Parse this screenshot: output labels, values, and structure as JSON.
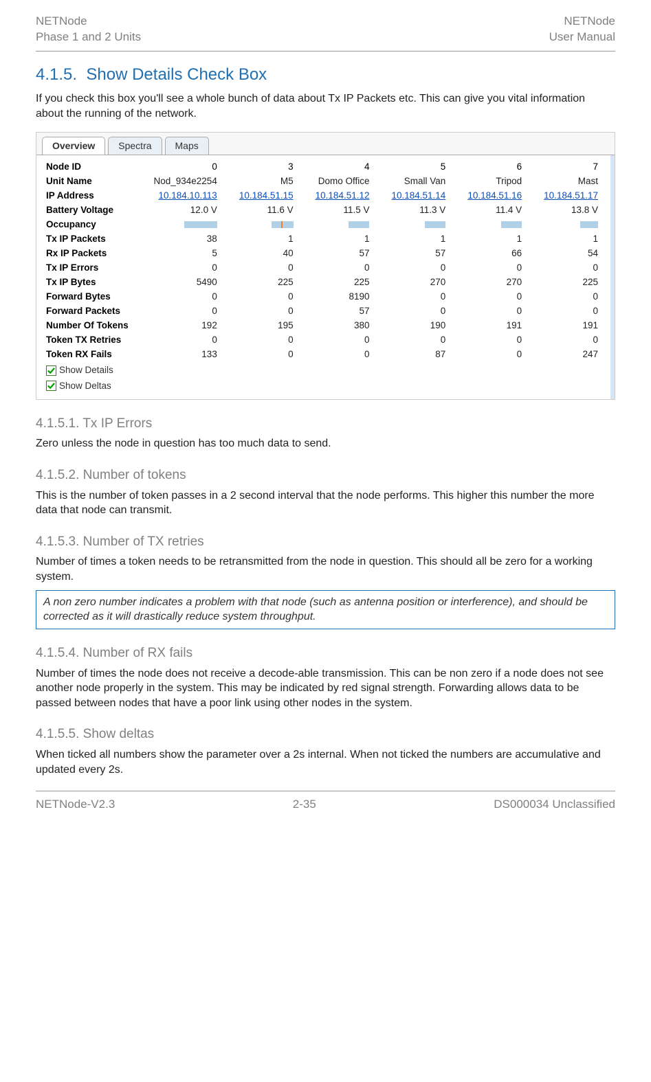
{
  "doc": {
    "header_left_1": "NETNode",
    "header_left_2": "Phase 1 and 2 Units",
    "header_right_1": "NETNode",
    "header_right_2": "User Manual",
    "footer_left": "NETNode-V2.3",
    "footer_center": "2-35",
    "footer_right": "DS000034 Unclassified"
  },
  "sections": {
    "h2_num": "4.1.5.",
    "h2_title": "Show Details Check Box",
    "p_intro": "If you check this box you'll see a whole bunch of data about Tx IP Packets etc. This can give you vital information about the running of the network.",
    "s1_h": "4.1.5.1. Tx IP Errors",
    "s1_p": "Zero unless the node in question has too much data to send.",
    "s2_h": "4.1.5.2. Number of tokens",
    "s2_p": "This is the number of token passes in a 2 second interval that the node performs. This higher this number the more data that node can transmit.",
    "s3_h": "4.1.5.3. Number of TX retries",
    "s3_p": "Number of times a token needs to be retransmitted from the node in question. This should all be zero for a working system.",
    "s3_note": "A non zero number indicates a problem with that node (such as antenna position or interference), and should be corrected as it will drastically reduce system throughput.",
    "s4_h": "4.1.5.4. Number of RX fails",
    "s4_p": "Number of times the node does not receive a decode-able transmission. This can be non zero if a node does not see another node properly in the system. This may be indicated by red signal strength. Forwarding allows data to be passed between nodes that have a poor link using other nodes in the system.",
    "s5_h": "4.1.5.5. Show deltas",
    "s5_p": "When ticked all numbers show the parameter over a 2s internal. When not ticked the numbers are accumulative and updated every 2s."
  },
  "app": {
    "tabs": {
      "t1": "Overview",
      "t2": "Spectra",
      "t3": "Maps"
    },
    "row_labels": {
      "node_id": "Node ID",
      "unit_name": "Unit Name",
      "ip": "IP Address",
      "batt": "Battery Voltage",
      "occ": "Occupancy",
      "txp": "Tx IP Packets",
      "rxp": "Rx IP Packets",
      "txe": "Tx IP Errors",
      "txb": "Tx IP Bytes",
      "fb": "Forward Bytes",
      "fp": "Forward Packets",
      "ntok": "Number Of Tokens",
      "ttr": "Token TX Retries",
      "trf": "Token RX Fails"
    },
    "checks": {
      "details": "Show Details",
      "deltas": "Show Deltas"
    },
    "cols": [
      {
        "id": "0",
        "name": "Nod_934e2254",
        "ip": "10.184.10.113",
        "batt": "12.0 V",
        "occ_w": 48,
        "occ_mark": null,
        "txp": "38",
        "rxp": "5",
        "txe": "0",
        "txb": "5490",
        "fb": "0",
        "fp": "0",
        "ntok": "192",
        "ttr": "0",
        "trf": "133"
      },
      {
        "id": "3",
        "name": "M5",
        "ip": "10.184.51.15",
        "batt": "11.6 V",
        "occ_w": 32,
        "occ_mark": 14,
        "txp": "1",
        "rxp": "40",
        "txe": "0",
        "txb": "225",
        "fb": "0",
        "fp": "0",
        "ntok": "195",
        "ttr": "0",
        "trf": "0"
      },
      {
        "id": "4",
        "name": "Domo Office",
        "ip": "10.184.51.12",
        "batt": "11.5 V",
        "occ_w": 30,
        "occ_mark": null,
        "txp": "1",
        "rxp": "57",
        "txe": "0",
        "txb": "225",
        "fb": "8190",
        "fp": "57",
        "ntok": "380",
        "ttr": "0",
        "trf": "0"
      },
      {
        "id": "5",
        "name": "Small Van",
        "ip": "10.184.51.14",
        "batt": "11.3 V",
        "occ_w": 30,
        "occ_mark": null,
        "txp": "1",
        "rxp": "57",
        "txe": "0",
        "txb": "270",
        "fb": "0",
        "fp": "0",
        "ntok": "190",
        "ttr": "0",
        "trf": "87"
      },
      {
        "id": "6",
        "name": "Tripod",
        "ip": "10.184.51.16",
        "batt": "11.4 V",
        "occ_w": 30,
        "occ_mark": null,
        "txp": "1",
        "rxp": "66",
        "txe": "0",
        "txb": "270",
        "fb": "0",
        "fp": "0",
        "ntok": "191",
        "ttr": "0",
        "trf": "0"
      },
      {
        "id": "7",
        "name": "Mast",
        "ip": "10.184.51.17",
        "batt": "13.8 V",
        "occ_w": 26,
        "occ_mark": null,
        "txp": "1",
        "rxp": "54",
        "txe": "0",
        "txb": "225",
        "fb": "0",
        "fp": "0",
        "ntok": "191",
        "ttr": "0",
        "trf": "247"
      }
    ]
  }
}
